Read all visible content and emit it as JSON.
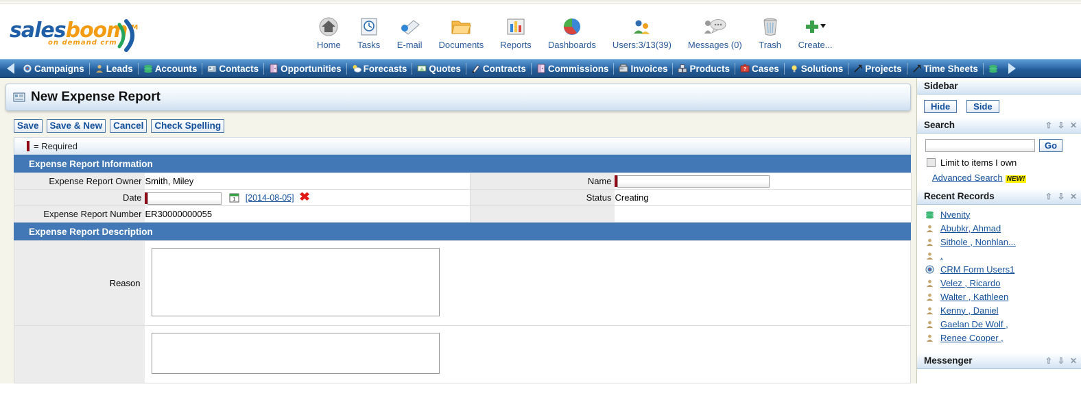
{
  "brand": {
    "name_part1": "sales",
    "name_part2": "boom",
    "tm": "TM",
    "tagline": "on demand crm"
  },
  "header": {
    "nav_icons": [
      {
        "label": "Home",
        "icon": "home-icon"
      },
      {
        "label": "Tasks",
        "icon": "tasks-clock-icon"
      },
      {
        "label": "E-mail",
        "icon": "email-envelope-icon"
      },
      {
        "label": "Documents",
        "icon": "documents-folder-icon"
      },
      {
        "label": "Reports",
        "icon": "reports-barchart-icon"
      },
      {
        "label": "Dashboards",
        "icon": "dashboards-piechart-icon"
      },
      {
        "label": "Users:3/13(39)",
        "icon": "users-people-icon"
      },
      {
        "label": "Messages (0)",
        "icon": "messages-bubble-icon"
      },
      {
        "label": "Trash",
        "icon": "trash-can-icon"
      },
      {
        "label": "Create...",
        "icon": "create-plus-icon"
      }
    ]
  },
  "module_bar": {
    "scroll_left": "scroll-left-arrow",
    "scroll_right": "scroll-right-arrow",
    "items": [
      {
        "label": "Campaigns",
        "icon": "campaigns-target-icon"
      },
      {
        "label": "Leads",
        "icon": "leads-person-icon"
      },
      {
        "label": "Accounts",
        "icon": "accounts-stack-icon"
      },
      {
        "label": "Contacts",
        "icon": "contacts-card-icon"
      },
      {
        "label": "Opportunities",
        "icon": "opportunities-door-icon"
      },
      {
        "label": "Forecasts",
        "icon": "forecasts-weather-icon"
      },
      {
        "label": "Quotes",
        "icon": "quotes-doc-icon"
      },
      {
        "label": "Contracts",
        "icon": "contracts-pen-icon"
      },
      {
        "label": "Commissions",
        "icon": "commissions-door-icon"
      },
      {
        "label": "Invoices",
        "icon": "invoices-register-icon"
      },
      {
        "label": "Products",
        "icon": "products-boxes-icon"
      },
      {
        "label": "Cases",
        "icon": "cases-briefcase-icon"
      },
      {
        "label": "Solutions",
        "icon": "solutions-bulb-icon"
      },
      {
        "label": "Projects",
        "icon": "projects-hammer-icon"
      },
      {
        "label": "Time Sheets",
        "icon": "timesheets-hammer-icon"
      }
    ],
    "end_icon": "accounts-stack-icon"
  },
  "page": {
    "title": "New Expense Report",
    "title_icon": "expense-report-icon",
    "buttons": [
      {
        "label": "Save",
        "name": "save-button"
      },
      {
        "label": "Save & New",
        "name": "save-and-new-button"
      },
      {
        "label": "Cancel",
        "name": "cancel-button"
      },
      {
        "label": "Check Spelling",
        "name": "check-spelling-button"
      }
    ],
    "required_legend": "= Required"
  },
  "sections": {
    "info": {
      "title": "Expense Report Information",
      "rows": [
        {
          "left_label": "Expense Report Owner",
          "left_type": "text",
          "left_value": "Smith, Miley",
          "right_label": "Name",
          "right_type": "input",
          "right_required": true,
          "right_value": ""
        },
        {
          "left_label": "Date",
          "left_type": "date",
          "left_required": true,
          "left_value": "",
          "date_link": "[2014-08-05]",
          "calendar_icon": "calendar-icon",
          "clear_icon": "clear-x-icon",
          "right_label": "Status",
          "right_type": "text",
          "right_value": "Creating"
        },
        {
          "left_label": "Expense Report Number",
          "left_type": "text",
          "left_value": "ER30000000055",
          "right_label": "",
          "right_type": "empty",
          "right_value": ""
        }
      ]
    },
    "description": {
      "title": "Expense Report Description",
      "rows": [
        {
          "label": "Reason",
          "value": ""
        },
        {
          "label": "",
          "value": ""
        }
      ]
    }
  },
  "sidebar": {
    "title": "Sidebar",
    "hide_label": "Hide",
    "side_label": "Side",
    "search": {
      "title": "Search",
      "value": "",
      "go_label": "Go",
      "limit_label": "Limit to items I own",
      "limit_checked": false,
      "advanced_label": "Advanced Search",
      "new_badge": "NEW!"
    },
    "recent": {
      "title": "Recent Records",
      "items": [
        {
          "label": "Nvenity",
          "icon": "account-stack-icon"
        },
        {
          "label": "Abubkr, Ahmad",
          "icon": "contact-person-icon"
        },
        {
          "label": " Sithole , Nonhlan...",
          "icon": "contact-person-icon"
        },
        {
          "label": " .",
          "icon": "contact-person-icon"
        },
        {
          "label": "CRM Form Users1",
          "icon": "campaign-target-icon"
        },
        {
          "label": " Velez , Ricardo",
          "icon": "contact-person-icon"
        },
        {
          "label": " Walter , Kathleen",
          "icon": "contact-person-icon"
        },
        {
          "label": " Kenny , Daniel",
          "icon": "contact-person-icon"
        },
        {
          "label": " Gaelan De Wolf ,",
          "icon": "contact-person-icon"
        },
        {
          "label": " Renee Cooper ,",
          "icon": "contact-person-icon"
        }
      ]
    },
    "messenger": {
      "title": "Messenger"
    },
    "panel_icons": {
      "up": "move-up-icon",
      "down": "move-down-icon",
      "close": "close-icon"
    }
  },
  "colors": {
    "module_bar_blue": "#2f6cab",
    "section_header_blue": "#4178b5",
    "link_blue": "#13509c",
    "required_red": "#8f0a16",
    "brand_blue": "#1f5fa8",
    "brand_orange": "#f39c12",
    "page_bg": "#f4f4ea"
  }
}
